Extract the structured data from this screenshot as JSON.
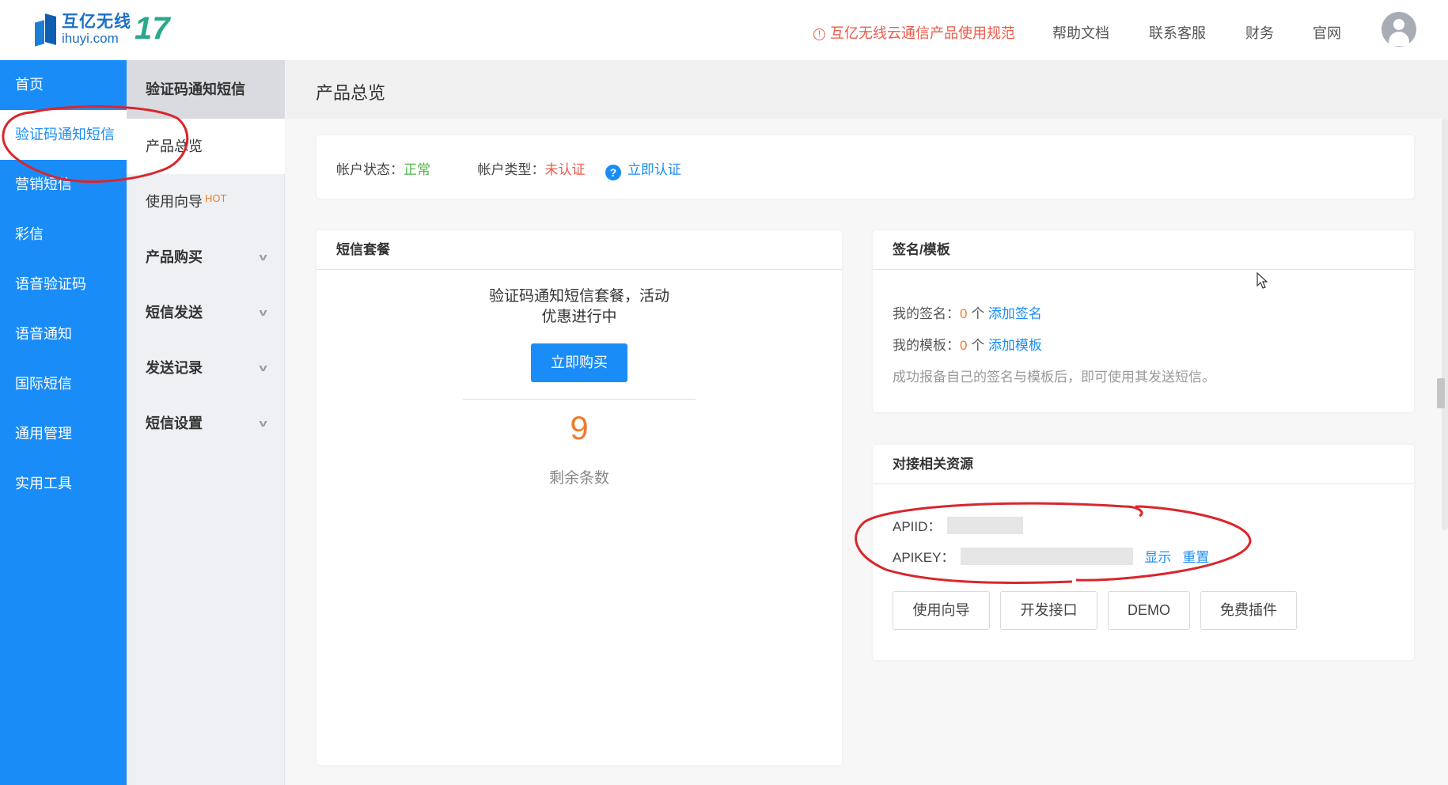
{
  "header": {
    "logo_cn": "互亿无线",
    "logo_en": "ihuyi.com",
    "logo_mark": "17",
    "notice": "互亿无线云通信产品使用规范",
    "links": [
      "帮助文档",
      "联系客服",
      "财务",
      "官网"
    ]
  },
  "sidebar_primary": {
    "items": [
      "首页",
      "验证码通知短信",
      "营销短信",
      "彩信",
      "语音验证码",
      "语音通知",
      "国际短信",
      "通用管理",
      "实用工具"
    ],
    "active_index": 1
  },
  "sidebar_secondary": {
    "title": "验证码通知短信",
    "items": [
      {
        "label": "产品总览"
      },
      {
        "label": "使用向导",
        "badge": "HOT"
      },
      {
        "label": "产品购买"
      },
      {
        "label": "短信发送"
      },
      {
        "label": "发送记录"
      },
      {
        "label": "短信设置"
      }
    ]
  },
  "page": {
    "title": "产品总览"
  },
  "account": {
    "status_label": "帐户状态：",
    "status_value": "正常",
    "type_label": "帐户类型：",
    "type_value": "未认证",
    "verify_link": "立即认证"
  },
  "package": {
    "title": "短信套餐",
    "desc_line1": "验证码通知短信套餐，活动",
    "desc_line2": "优惠进行中",
    "buy_button": "立即购买",
    "remaining_count": "9",
    "remaining_label": "剩余条数"
  },
  "signature": {
    "title": "签名/模板",
    "sign_label": "我的签名：",
    "sign_count": "0",
    "unit": "个",
    "add_sign": "添加签名",
    "template_label": "我的模板：",
    "template_count": "0",
    "add_template": "添加模板",
    "hint": "成功报备自己的签名与模板后，即可使用其发送短信。"
  },
  "resources": {
    "title": "对接相关资源",
    "apiid_label": "APIID：",
    "apikey_label": "APIKEY：",
    "show_link": "显示",
    "reset_link": "重置",
    "buttons": [
      "使用向导",
      "开发接口",
      "DEMO",
      "免费插件"
    ]
  },
  "colors": {
    "primary_blue": "#1a8cf7",
    "success_green": "#52b64a",
    "warning_red": "#ee5a4a",
    "highlight_orange": "#f07b2b",
    "annotation_red": "#d9262c"
  }
}
